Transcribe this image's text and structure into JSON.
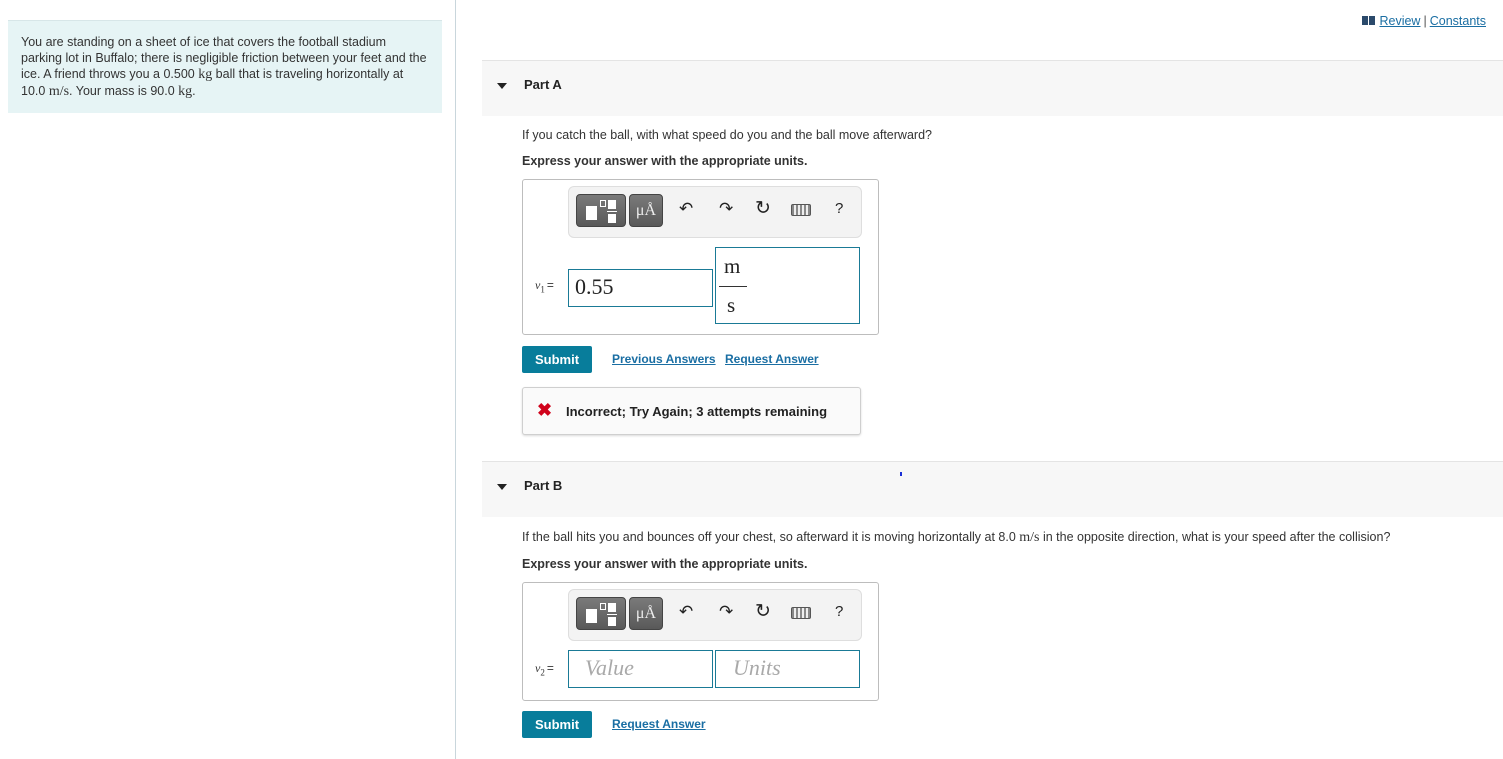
{
  "problem": {
    "text_1": "You are standing on a sheet of ice that covers the football stadium parking lot in Buffalo; there is negligible friction between your feet and the ice. A friend throws you a 0.500 ",
    "unit_kg": "kg",
    "text_2": " ball that is traveling horizontally at 10.0 ",
    "unit_ms": "m/s",
    "text_3": ". Your mass is 90.0 ",
    "unit_kg2": "kg",
    "text_4": "."
  },
  "top_links": {
    "review": "Review",
    "separator": "|",
    "constants": "Constants"
  },
  "toolbar": {
    "units_label": "μÅ",
    "undo": "↶",
    "redo": "↷",
    "reset": "↻",
    "help": "?"
  },
  "part_a": {
    "title": "Part A",
    "question": "If you catch the ball, with what speed do you and the ball move afterward?",
    "instruction": "Express your answer with the appropriate units.",
    "var_name": "v",
    "var_sub": "1",
    "eq": "=",
    "value": "0.55",
    "unit_numerator": "m",
    "unit_denominator": "s",
    "submit": "Submit",
    "previous_answers": "Previous Answers",
    "request_answer": "Request Answer",
    "feedback": "Incorrect; Try Again; 3 attempts remaining",
    "feedback_icon": "✖"
  },
  "part_b": {
    "title": "Part B",
    "question_1": "If the ball hits you and bounces off your chest, so afterward it is moving horizontally at 8.0 ",
    "question_unit": "m/s",
    "question_2": " in the opposite direction, what is your speed after the collision?",
    "instruction": "Express your answer with the appropriate units.",
    "var_name": "v",
    "var_sub": "2",
    "eq": "=",
    "value_placeholder": "Value",
    "units_placeholder": "Units",
    "submit": "Submit",
    "request_answer": "Request Answer"
  }
}
